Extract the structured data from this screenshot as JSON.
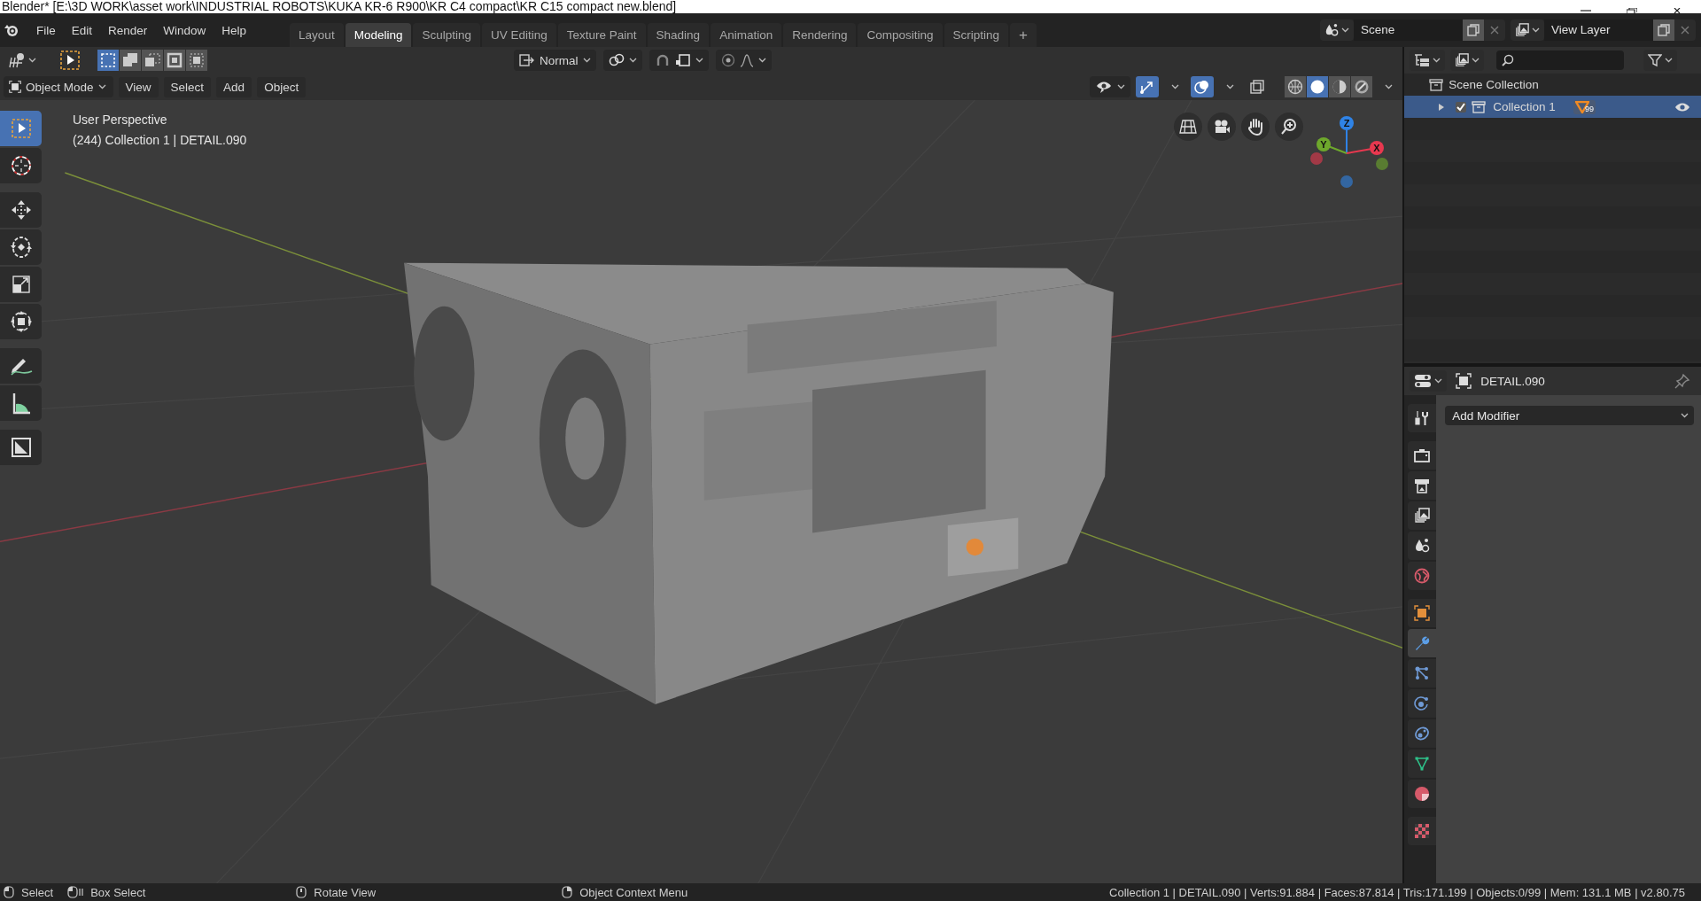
{
  "window": {
    "title": "Blender* [E:\\3D WORK\\asset work\\INDUSTRIAL ROBOTS\\KUKA KR-6 R900\\KR C4 compact\\KR C15 compact new.blend]"
  },
  "menu": [
    "File",
    "Edit",
    "Render",
    "Window",
    "Help"
  ],
  "workspaces": [
    {
      "label": "Layout",
      "selected": false
    },
    {
      "label": "Modeling",
      "selected": true
    },
    {
      "label": "Sculpting",
      "selected": false
    },
    {
      "label": "UV Editing",
      "selected": false
    },
    {
      "label": "Texture Paint",
      "selected": false
    },
    {
      "label": "Shading",
      "selected": false
    },
    {
      "label": "Animation",
      "selected": false
    },
    {
      "label": "Rendering",
      "selected": false
    },
    {
      "label": "Compositing",
      "selected": false
    },
    {
      "label": "Scripting",
      "selected": false
    }
  ],
  "add_workspace": "+",
  "scene": {
    "value": "Scene"
  },
  "view_layer": {
    "value": "View Layer"
  },
  "viewport": {
    "select_modes": [
      {
        "selected": true
      },
      {
        "selected": false
      },
      {
        "selected": false
      },
      {
        "selected": false
      },
      {
        "selected": false
      }
    ],
    "orientation": "Normal",
    "mode": "Object Mode",
    "menus": [
      "View",
      "Select",
      "Add",
      "Object"
    ],
    "gizmos_on": true,
    "overlays_on": true,
    "shading_modes": [
      {
        "selected": false
      },
      {
        "selected": true
      },
      {
        "selected": false
      },
      {
        "selected": false
      }
    ],
    "info": [
      "User Perspective",
      "(244) Collection 1 | DETAIL.090"
    ],
    "tools": [
      {
        "kind": "select",
        "selected": true
      },
      {
        "kind": "cursor",
        "selected": false
      },
      {
        "kind": "move",
        "selected": false
      },
      {
        "kind": "rotate",
        "selected": false
      },
      {
        "kind": "scale",
        "selected": false
      },
      {
        "kind": "transform",
        "selected": false
      },
      {
        "kind": "annotate",
        "selected": false
      },
      {
        "kind": "measure",
        "selected": false
      },
      {
        "kind": "add_cube",
        "selected": false
      }
    ],
    "gizmo_axes": [
      {
        "label": "Z",
        "color": "#2f83e6"
      },
      {
        "label": "Y",
        "color": "#6ea82c"
      },
      {
        "label": "X",
        "color": "#e8384f"
      }
    ],
    "scene_view": {
      "kind": "picture"
    }
  },
  "outliner": {
    "items": [
      {
        "label": "Scene Collection",
        "children": [
          {
            "label": "Collection 1",
            "selected": true,
            "checked": true,
            "expanded": false,
            "badge": "99"
          }
        ]
      }
    ]
  },
  "properties": {
    "object": "DETAIL.090",
    "tabs": [
      {
        "kind": "tool",
        "selected": false
      },
      {
        "kind": "render",
        "selected": false
      },
      {
        "kind": "output",
        "selected": false
      },
      {
        "kind": "view_layer",
        "selected": false
      },
      {
        "kind": "scene",
        "selected": false
      },
      {
        "kind": "world",
        "selected": false
      },
      {
        "kind": "object",
        "selected": false
      },
      {
        "kind": "modifiers",
        "selected": true
      },
      {
        "kind": "particles",
        "selected": false
      },
      {
        "kind": "physics",
        "selected": false
      },
      {
        "kind": "constraints",
        "selected": false
      },
      {
        "kind": "data",
        "selected": false
      },
      {
        "kind": "material",
        "selected": false
      },
      {
        "kind": "texture",
        "selected": false
      }
    ],
    "add_modifier": "Add Modifier"
  },
  "status_bar": {
    "hints": [
      "Select",
      "Box Select",
      "Rotate View",
      "Object Context Menu"
    ],
    "stats": "Collection 1 | DETAIL.090 | Verts:91.884 | Faces:87.814 | Tris:171.199 | Objects:0/99 | Mem: 131.1 MB | v2.80.75"
  }
}
